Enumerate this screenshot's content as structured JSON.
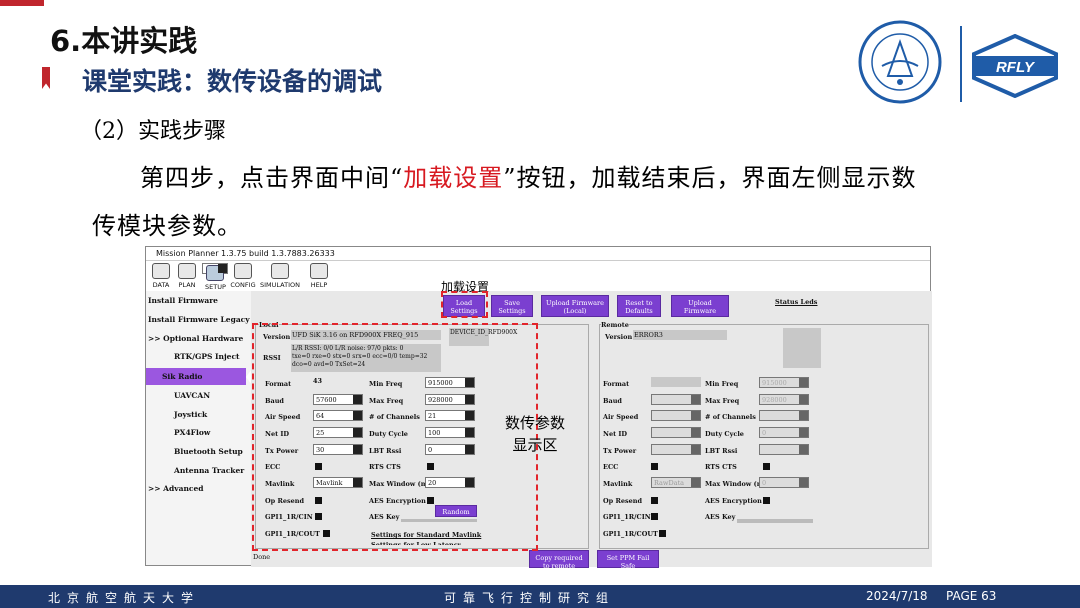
{
  "header": {
    "section_title": "6.本讲实践",
    "subtitle": "课堂实践：数传设备的调试",
    "step_heading": "（2）实践步骤",
    "para_part1": "第四步，点击界面中间“",
    "para_highlight": "加载设置",
    "para_part2": "”按钮，加载结束后，界面左侧显示数",
    "para_line2": "传模块参数。"
  },
  "logos": {
    "rfly_text": "RFLY"
  },
  "footer": {
    "left": "北京航空航天大学",
    "center": "可靠飞行控制研究组",
    "date": "2024/7/18",
    "page": "PAGE 63"
  },
  "app": {
    "window_title": "Mission Planner 1.3.75 build 1.3.7883.26333",
    "menu": [
      "DATA",
      "PLAN",
      "SETUP",
      "CONFIG",
      "SIMULATION",
      "HELP"
    ],
    "sidebar": [
      "Install Firmware",
      "Install Firmware Legacy",
      ">> Optional Hardware",
      "RTK/GPS Inject",
      "Sik Radio",
      "UAVCAN",
      "Joystick",
      "PX4Flow",
      "Bluetooth Setup",
      "Antenna Tracker",
      ">> Advanced"
    ],
    "buttons": {
      "load": [
        "Load",
        "Settings"
      ],
      "save": [
        "Save",
        "Settings"
      ],
      "upload_fw": [
        "Upload Firmware",
        "(Local)"
      ],
      "reset": [
        "Reset to",
        "Defaults"
      ],
      "upload_custom": [
        "Upload",
        "Firmware"
      ],
      "status_leds": "Status Leds",
      "copy_remote": [
        "Copy required",
        "to remote"
      ],
      "set_ppm": [
        "Set PPM Fail",
        "Safe"
      ]
    },
    "local": {
      "group": "Local",
      "version_label": "Version",
      "version_value": "UFD SiK 3.16 on RFD900X  FREQ_915",
      "device_id": "DEVICE_ID_RFD900X",
      "rssi_label": "RSSI",
      "rssi_line1": "L/R RSSI: 0/0  L/R noise: 97/0 pkts: 0",
      "rssi_line2": "txe=0 rxe=0 stx=0 srx=0 ecc=0/0 temp=32",
      "rssi_line3": "dco=0 avd=0 TxSet=24",
      "format_label": "Format",
      "format_value": "43",
      "baud_label": "Baud",
      "baud_value": "57600",
      "airspeed_label": "Air Speed",
      "airspeed_value": "64",
      "netid_label": "Net ID",
      "netid_value": "25",
      "txpower_label": "Tx Power",
      "txpower_value": "30",
      "ecc_label": "ECC",
      "mavlink_label": "Mavlink",
      "mavlink_value": "Mavlink",
      "opresend_label": "Op Resend",
      "gpi1_label": "GPI1_1R/CIN",
      "gpo1_label": "GPI1_1R/COUT",
      "minfreq_label": "Min Freq",
      "minfreq_value": "915000",
      "maxfreq_label": "Max Freq",
      "maxfreq_value": "928000",
      "channels_label": "# of Channels",
      "channels_value": "21",
      "duty_label": "Duty Cycle",
      "duty_value": "100",
      "lbt_label": "LBT Rssi",
      "lbt_value": "0",
      "rtscts_label": "RTS CTS",
      "maxwin_label": "Max Window (ms)",
      "maxwin_value": "20",
      "aes_enc_label": "AES Encryption",
      "aes_key_label": "AES Key",
      "random_label": "Random",
      "settings_link": "Settings for Standard Mavlink",
      "settings_link2": "Settings for Low Latency"
    },
    "remote": {
      "group": "Remote",
      "version_label": "Version",
      "version_value": "ERROR3",
      "format_label": "Format",
      "baud_label": "Baud",
      "airspeed_label": "Air Speed",
      "netid_label": "Net ID",
      "txpower_label": "Tx Power",
      "ecc_label": "ECC",
      "mavlink_label": "Mavlink",
      "mavlink_value": "RawData",
      "opresend_label": "Op Resend",
      "gpi1_label": "GPI1_1R/CIN",
      "gpo1_label": "GPI1_1R/COUT",
      "minfreq_label": "Min Freq",
      "minfreq_value": "915000",
      "maxfreq_label": "Max Freq",
      "maxfreq_value": "928000",
      "channels_label": "# of Channels",
      "duty_label": "Duty Cycle",
      "duty_value": "0",
      "lbt_label": "LBT Rssi",
      "rtscts_label": "RTS CTS",
      "maxwin_label": "Max Window (ms)",
      "maxwin_value": "0",
      "aes_enc_label": "AES Encryption",
      "aes_key_label": "AES Key"
    },
    "status": "Done"
  },
  "annotations": {
    "load_label": "加载设置",
    "area_line1": "数传参数",
    "area_line2": "显示区"
  },
  "colors": {
    "accent_red": "#d71920",
    "navy": "#1f3a6e",
    "purple_button": "#7b3fd0"
  }
}
